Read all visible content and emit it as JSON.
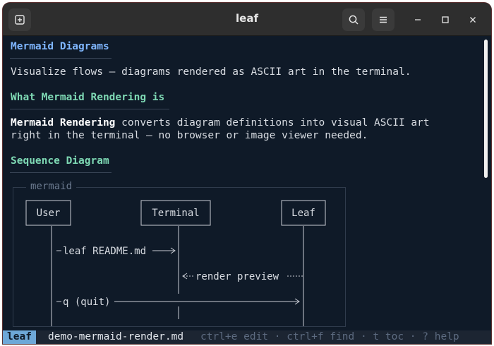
{
  "window": {
    "title": "leaf",
    "new_tab_icon": "new-tab-icon",
    "search_icon": "search-icon",
    "menu_icon": "hamburger-menu-icon"
  },
  "document": {
    "h1": "Mermaid Diagrams",
    "intro": "Visualize flows — diagrams rendered as ASCII art in the terminal.",
    "h2_what": "What Mermaid Rendering is",
    "para_bold": "Mermaid Rendering",
    "para_rest_1": " converts diagram definitions into visual ASCII art",
    "para_line_2": "right in the terminal — no browser or image viewer needed.",
    "h2_sequence": "Sequence Diagram"
  },
  "diagram": {
    "label": "mermaid",
    "participants": [
      "User",
      "Terminal",
      "Leaf"
    ],
    "messages": [
      {
        "text": "leaf README.md",
        "from": "User",
        "to": "Terminal",
        "style": "solid"
      },
      {
        "text": "render preview",
        "from": "Leaf",
        "to": "Terminal",
        "style": "dotted"
      },
      {
        "text": "q (quit)",
        "from": "User",
        "to": "Leaf",
        "style": "solid"
      }
    ]
  },
  "statusbar": {
    "mode": "leaf",
    "file": "demo-mermaid-render.md",
    "hints": "ctrl+e edit · ctrl+f find · t toc · ? help"
  },
  "colors": {
    "background": "#0f1a28",
    "heading1": "#7fb6ff",
    "heading2": "#7ed9b4",
    "mode_badge": "#6ea8d8"
  }
}
